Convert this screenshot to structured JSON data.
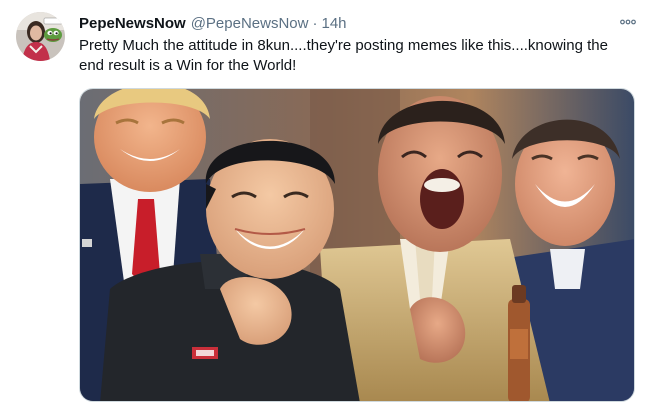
{
  "tweet": {
    "display_name": "PepeNewsNow",
    "handle": "@PepeNewsNow",
    "separator": "·",
    "time": "14h",
    "text": "Pretty Much the attitude in 8kun....they're posting memes like this....knowing the end result is a Win for the World!"
  },
  "icons": {
    "more": "more-horizontal-icon",
    "avatar": "profile-avatar"
  },
  "colors": {
    "text_primary": "#0f1419",
    "text_secondary": "#5b7083",
    "border": "#cfd9de"
  }
}
